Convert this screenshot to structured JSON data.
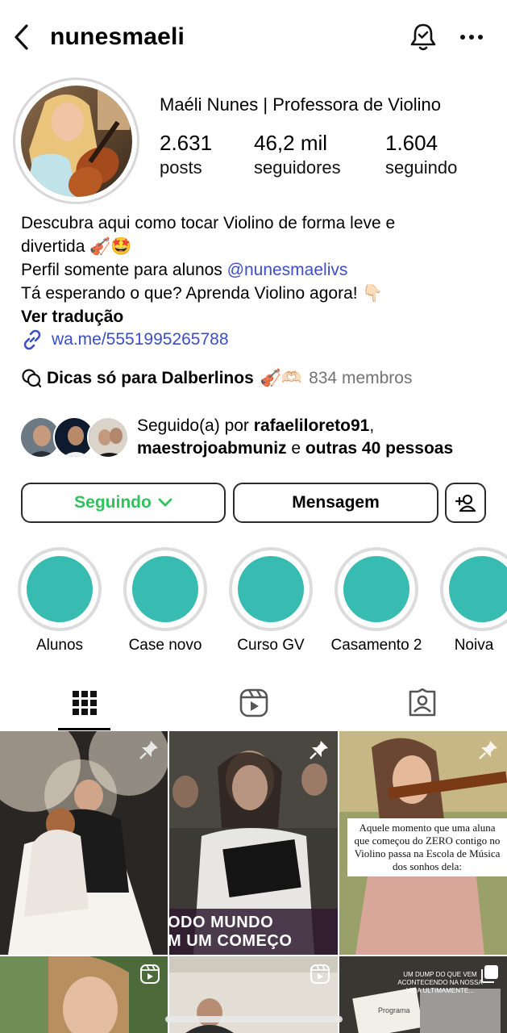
{
  "header": {
    "username": "nunesmaeli"
  },
  "profile": {
    "display_name": "Maéli Nunes | Professora de Violino",
    "stats": [
      {
        "value": "2.631",
        "label": "posts"
      },
      {
        "value": "46,2 mil",
        "label": "seguidores"
      },
      {
        "value": "1.604",
        "label": "seguindo"
      }
    ]
  },
  "bio": {
    "line1": "Descubra aqui como tocar Violino de forma leve e",
    "line2": "divertida 🎻🤩",
    "line3_prefix": "Perfil somente para alunos ",
    "line3_mention": "@nunesmaelivs",
    "line4": "Tá esperando o que? Aprenda Violino agora! 👇🏻",
    "translate": "Ver tradução",
    "link": "wa.me/5551995265788"
  },
  "channel": {
    "name": "Dicas só para Dalberlinos",
    "emoji": "🎻🫶🏻",
    "count": "834 membros"
  },
  "followed_by": {
    "prefix": "Seguido(a) por ",
    "user1": "rafaeliloreto91",
    "sep1": ",",
    "user2": "maestrojoabmuniz",
    "and": " e ",
    "others": "outras 40 pessoas"
  },
  "actions": {
    "following": "Seguindo",
    "message": "Mensagem"
  },
  "highlights": [
    {
      "label": "Alunos"
    },
    {
      "label": "Case novo"
    },
    {
      "label": "Curso GV"
    },
    {
      "label": "Casamento 2"
    },
    {
      "label": "Noiva"
    }
  ],
  "posts": {
    "post2_overlay_1": "ODO MUNDO",
    "post2_overlay_2": "M UM COMEÇO",
    "post3_caption": "Aquele momento que uma aluna que começou do ZERO contigo no Violino passa na Escola de Música dos sonhos dela:",
    "post6_caption": "UM DUMP DO QUE VEM ACONTECENDO NA NOSSA VIDA ULTIMAMENTE...",
    "post6_book_title": "Programa"
  },
  "colors": {
    "accent_green": "#2ec45b",
    "link_blue": "#3c4ec6",
    "highlight_teal": "#38bcb2"
  }
}
